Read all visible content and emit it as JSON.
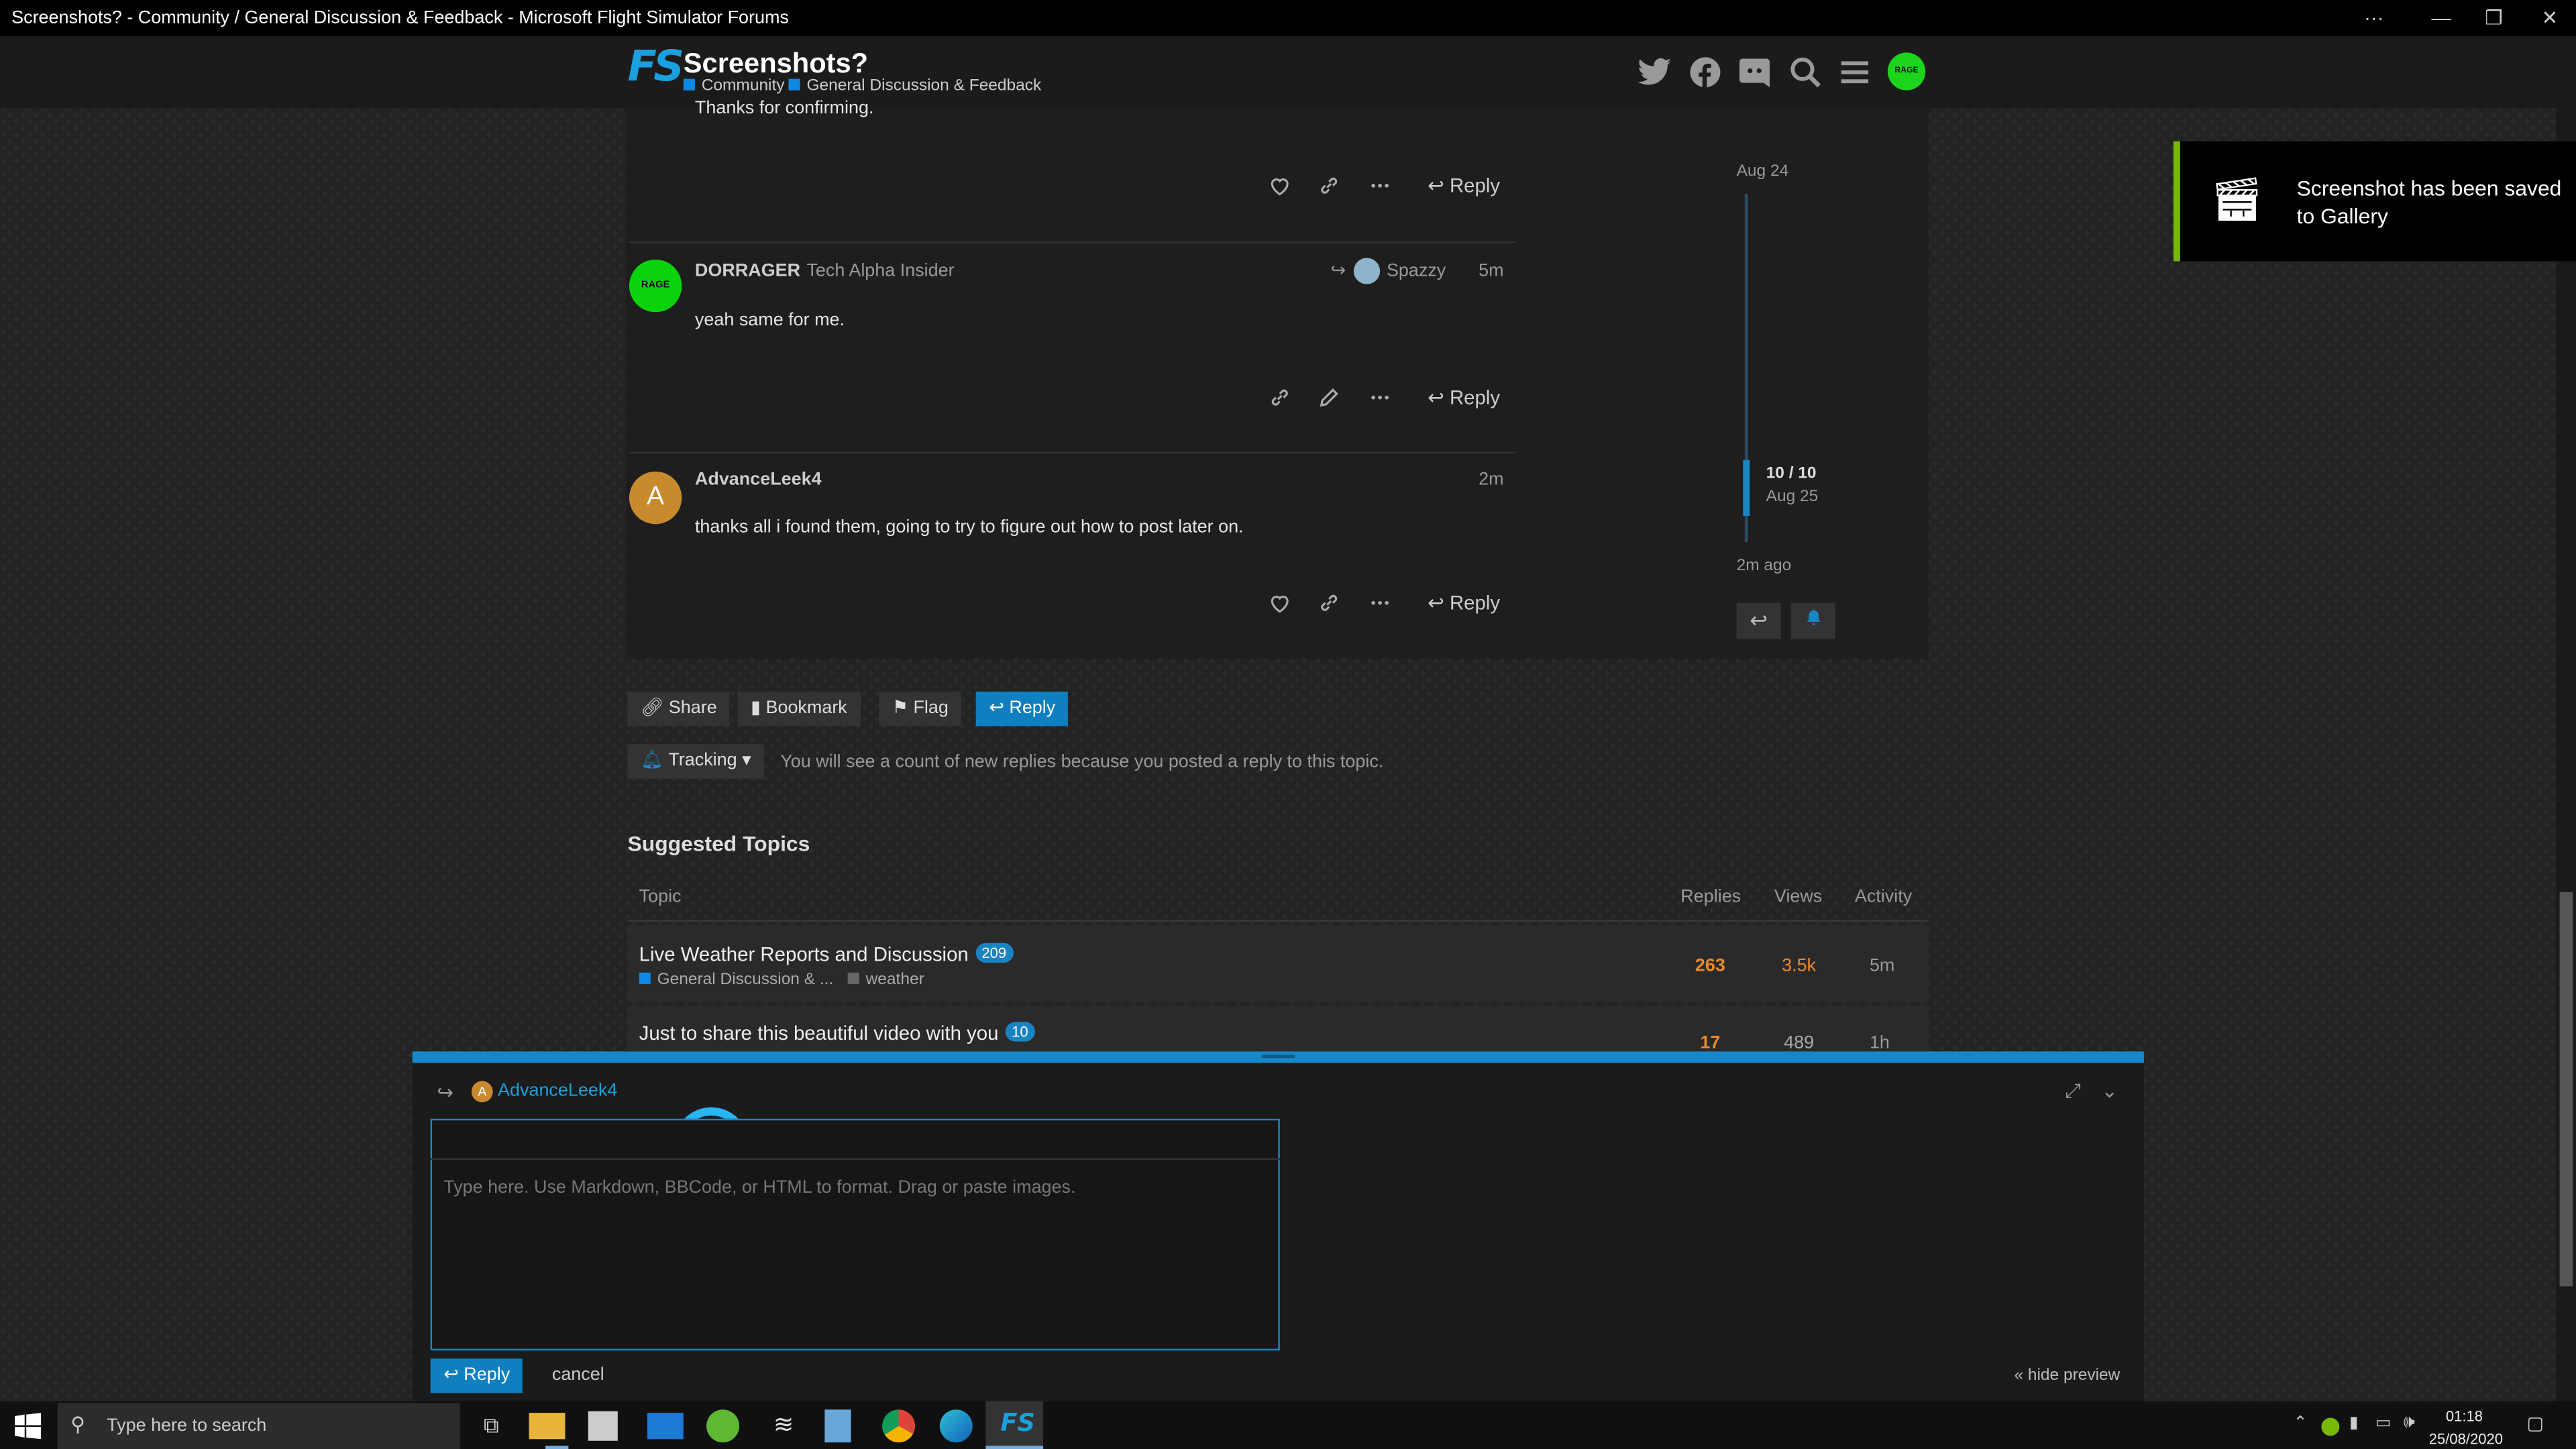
{
  "window": {
    "title": "Screenshots? - Community / General Discussion & Feedback - Microsoft Flight Simulator Forums"
  },
  "header": {
    "logo_text": "FS",
    "topic_title": "Screenshots?",
    "crumbs": [
      "Community",
      "General Discussion & Feedback"
    ],
    "avatar_text": "RAGE"
  },
  "posts": [
    {
      "partial_text": "Thanks for confirming.",
      "reply_label": "Reply"
    },
    {
      "user": "DORRAGER",
      "user_title": "Tech Alpha Insider",
      "reply_to": "Spazzy",
      "age": "5m",
      "text": "yeah same for me.",
      "avatar_text": "RAGE",
      "reply_label": "Reply"
    },
    {
      "user": "AdvanceLeek4",
      "age": "2m",
      "text": "thanks all i found them, going to try to figure out how to post later on.",
      "avatar_letter": "A",
      "reply_label": "Reply"
    }
  ],
  "timeline": {
    "start": "Aug 24",
    "position": "10 / 10",
    "position_date": "Aug 25",
    "end": "2m ago"
  },
  "footer_buttons": {
    "share": "Share",
    "bookmark": "Bookmark",
    "flag": "Flag",
    "reply": "Reply"
  },
  "tracking": {
    "label": "Tracking",
    "message": "You will see a count of new replies because you posted a reply to this topic."
  },
  "suggested": {
    "heading": "Suggested Topics",
    "columns": [
      "Topic",
      "Replies",
      "Views",
      "Activity"
    ],
    "rows": [
      {
        "title": "Live Weather Reports and Discussion",
        "badge": "209",
        "category": "General Discussion & ...",
        "tag": "weather",
        "replies": "263",
        "views": "3.5k",
        "activity": "5m"
      },
      {
        "title": "Just to share this beautiful video with you",
        "badge": "10",
        "replies": "17",
        "views": "489",
        "activity": "1h"
      }
    ]
  },
  "composer": {
    "reply_to": "AdvanceLeek4",
    "placeholder": "Type here. Use Markdown, BBCode, or HTML to format. Drag or paste images.",
    "reply_label": "Reply",
    "cancel_label": "cancel",
    "hide_preview": "« hide preview",
    "highlight_color": "#29b6f6"
  },
  "notification": {
    "text": "Screenshot has been saved to Gallery",
    "accent": "#76b900"
  },
  "taskbar": {
    "search_placeholder": "Type here to search",
    "time": "01:18",
    "date": "25/08/2020"
  }
}
